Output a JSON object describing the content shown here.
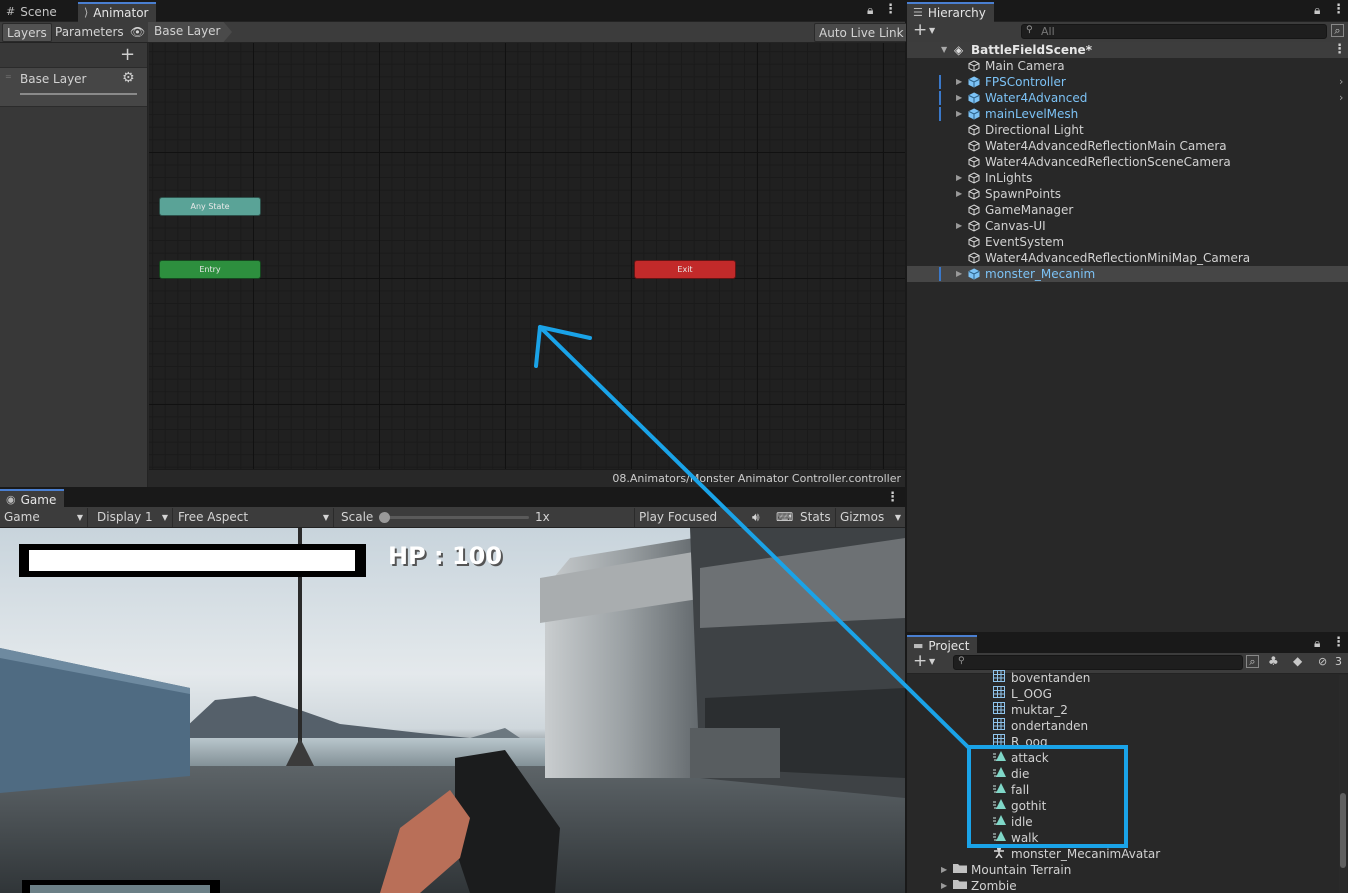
{
  "top_tabs": {
    "scene": "Scene",
    "animator": "Animator"
  },
  "animator": {
    "tabs": {
      "layers": "Layers",
      "parameters": "Parameters"
    },
    "breadcrumb": "Base Layer",
    "auto_live_link": "Auto Live Link",
    "add": "+",
    "layer_name": "Base Layer",
    "nodes": {
      "any_state": "Any State",
      "entry": "Entry",
      "exit": "Exit"
    },
    "footer_path": "08.Animators/Monster Animator Controller.controller"
  },
  "game": {
    "tab": "Game",
    "display_mode": "Game",
    "display": "Display 1",
    "aspect": "Free Aspect",
    "scale_label": "Scale",
    "scale_value": "1x",
    "play_focused": "Play Focused",
    "stats": "Stats",
    "gizmos": "Gizmos",
    "hp_text": "HP : 100"
  },
  "hierarchy": {
    "tab": "Hierarchy",
    "search_placeholder": "All",
    "scene_name": "BattleFieldScene*",
    "items": [
      {
        "label": "Main Camera",
        "prefab": false,
        "foldable": false
      },
      {
        "label": "FPSController",
        "prefab": true,
        "foldable": true
      },
      {
        "label": "Water4Advanced",
        "prefab": true,
        "foldable": true
      },
      {
        "label": "mainLevelMesh",
        "prefab": true,
        "foldable": true
      },
      {
        "label": "Directional Light",
        "prefab": false,
        "foldable": false
      },
      {
        "label": "Water4AdvancedReflectionMain Camera",
        "prefab": false,
        "foldable": false
      },
      {
        "label": "Water4AdvancedReflectionSceneCamera",
        "prefab": false,
        "foldable": false
      },
      {
        "label": "InLights",
        "prefab": false,
        "foldable": true
      },
      {
        "label": "SpawnPoints",
        "prefab": false,
        "foldable": true
      },
      {
        "label": "GameManager",
        "prefab": false,
        "foldable": false
      },
      {
        "label": "Canvas-UI",
        "prefab": false,
        "foldable": true
      },
      {
        "label": "EventSystem",
        "prefab": false,
        "foldable": false
      },
      {
        "label": "Water4AdvancedReflectionMiniMap_Camera",
        "prefab": false,
        "foldable": false
      },
      {
        "label": "monster_Mecanim",
        "prefab": true,
        "foldable": true
      }
    ]
  },
  "project": {
    "tab": "Project",
    "hidden_count": "3",
    "meshes": [
      "boventanden",
      "L_OOG",
      "muktar_2",
      "ondertanden",
      "R_oog"
    ],
    "clips": [
      "attack",
      "die",
      "fall",
      "gothit",
      "idle",
      "walk"
    ],
    "avatar": "monster_MecanimAvatar",
    "folders": [
      "Mountain Terrain",
      "Zombie"
    ]
  },
  "colors": {
    "accent": "#4a7fd1",
    "annotation": "#1aa3e8",
    "any_state": "#5aa397",
    "entry": "#2d8f3e",
    "exit": "#c22a2a",
    "prefab": "#7cc2f5"
  }
}
